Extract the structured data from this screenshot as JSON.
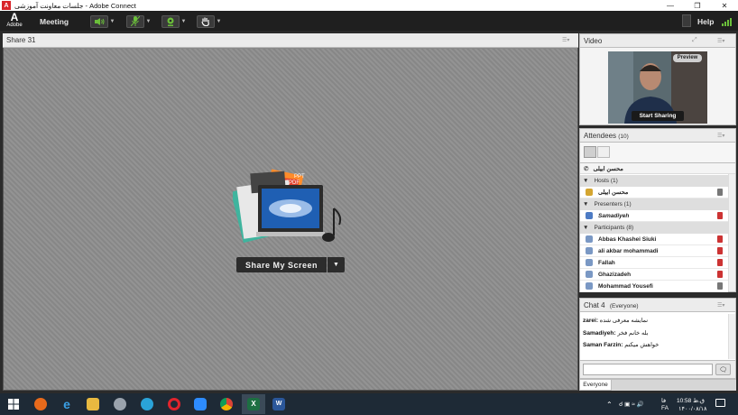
{
  "window": {
    "title": "جلسات معاونت آموزشی - Adobe Connect",
    "app_icon_text": "A"
  },
  "menubar": {
    "logo_sub": "Adobe",
    "meeting": "Meeting",
    "help": "Help"
  },
  "share": {
    "title": "Share 31",
    "button": "Share My Screen",
    "graphic_labels": {
      "ppt": "PPT",
      "pdf": "PDF"
    }
  },
  "video": {
    "title": "Video",
    "preview": "Preview",
    "start_sharing": "Start Sharing"
  },
  "attendees": {
    "title": "Attendees",
    "count": "(10)",
    "me": "محسن ابیلی",
    "sections": [
      {
        "label": "Hosts (1)",
        "users": [
          "محسن ابیلی"
        ]
      },
      {
        "label": "Presenters (1)",
        "users": [
          "Samadiyeh"
        ]
      },
      {
        "label": "Participants (8)",
        "users": [
          "Abbas Khashei Siuki",
          "ali akbar mohammadi",
          "Fallah",
          "Ghazizadeh",
          "Mohammad Yousefi"
        ]
      }
    ]
  },
  "chat": {
    "title": "Chat 4",
    "scope": "(Everyone)",
    "messages": [
      {
        "sender": "zarei:",
        "text": "نمایشه معرفی شده"
      },
      {
        "sender": "Samadiyeh:",
        "text": "بله خانم فخر"
      },
      {
        "sender": "Saman Farzin:",
        "text": "خواهش میکنم"
      }
    ],
    "tab": "Everyone"
  },
  "taskbar": {
    "time": "10:58 ق.ظ",
    "date": "۱۴۰۰/۰۸/۱۸",
    "lang_top": "فا",
    "lang_bottom": "FA"
  },
  "colors": {
    "accent_green": "#6bbf3a",
    "mic_red": "#c33333",
    "taskbar": "#1e2a36"
  }
}
